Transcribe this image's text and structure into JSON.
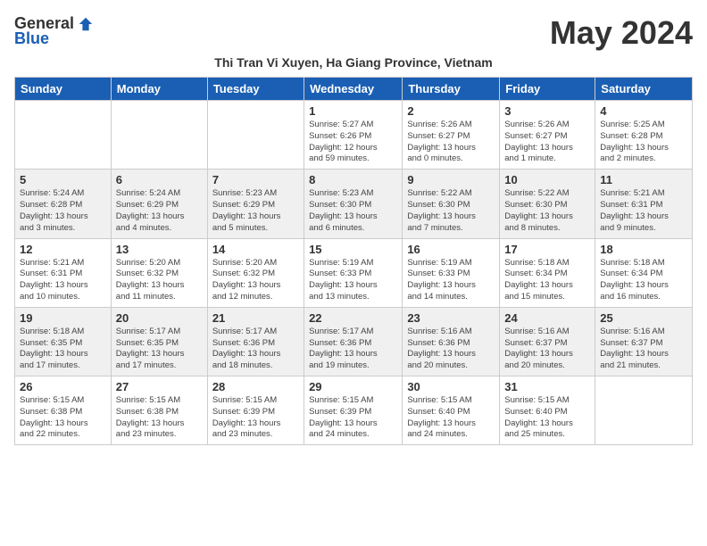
{
  "header": {
    "logo_general": "General",
    "logo_blue": "Blue",
    "month_title": "May 2024",
    "subtitle": "Thi Tran Vi Xuyen, Ha Giang Province, Vietnam"
  },
  "weekdays": [
    "Sunday",
    "Monday",
    "Tuesday",
    "Wednesday",
    "Thursday",
    "Friday",
    "Saturday"
  ],
  "weeks": [
    [
      {
        "day": "",
        "info": ""
      },
      {
        "day": "",
        "info": ""
      },
      {
        "day": "",
        "info": ""
      },
      {
        "day": "1",
        "info": "Sunrise: 5:27 AM\nSunset: 6:26 PM\nDaylight: 12 hours\nand 59 minutes."
      },
      {
        "day": "2",
        "info": "Sunrise: 5:26 AM\nSunset: 6:27 PM\nDaylight: 13 hours\nand 0 minutes."
      },
      {
        "day": "3",
        "info": "Sunrise: 5:26 AM\nSunset: 6:27 PM\nDaylight: 13 hours\nand 1 minute."
      },
      {
        "day": "4",
        "info": "Sunrise: 5:25 AM\nSunset: 6:28 PM\nDaylight: 13 hours\nand 2 minutes."
      }
    ],
    [
      {
        "day": "5",
        "info": "Sunrise: 5:24 AM\nSunset: 6:28 PM\nDaylight: 13 hours\nand 3 minutes."
      },
      {
        "day": "6",
        "info": "Sunrise: 5:24 AM\nSunset: 6:29 PM\nDaylight: 13 hours\nand 4 minutes."
      },
      {
        "day": "7",
        "info": "Sunrise: 5:23 AM\nSunset: 6:29 PM\nDaylight: 13 hours\nand 5 minutes."
      },
      {
        "day": "8",
        "info": "Sunrise: 5:23 AM\nSunset: 6:30 PM\nDaylight: 13 hours\nand 6 minutes."
      },
      {
        "day": "9",
        "info": "Sunrise: 5:22 AM\nSunset: 6:30 PM\nDaylight: 13 hours\nand 7 minutes."
      },
      {
        "day": "10",
        "info": "Sunrise: 5:22 AM\nSunset: 6:30 PM\nDaylight: 13 hours\nand 8 minutes."
      },
      {
        "day": "11",
        "info": "Sunrise: 5:21 AM\nSunset: 6:31 PM\nDaylight: 13 hours\nand 9 minutes."
      }
    ],
    [
      {
        "day": "12",
        "info": "Sunrise: 5:21 AM\nSunset: 6:31 PM\nDaylight: 13 hours\nand 10 minutes."
      },
      {
        "day": "13",
        "info": "Sunrise: 5:20 AM\nSunset: 6:32 PM\nDaylight: 13 hours\nand 11 minutes."
      },
      {
        "day": "14",
        "info": "Sunrise: 5:20 AM\nSunset: 6:32 PM\nDaylight: 13 hours\nand 12 minutes."
      },
      {
        "day": "15",
        "info": "Sunrise: 5:19 AM\nSunset: 6:33 PM\nDaylight: 13 hours\nand 13 minutes."
      },
      {
        "day": "16",
        "info": "Sunrise: 5:19 AM\nSunset: 6:33 PM\nDaylight: 13 hours\nand 14 minutes."
      },
      {
        "day": "17",
        "info": "Sunrise: 5:18 AM\nSunset: 6:34 PM\nDaylight: 13 hours\nand 15 minutes."
      },
      {
        "day": "18",
        "info": "Sunrise: 5:18 AM\nSunset: 6:34 PM\nDaylight: 13 hours\nand 16 minutes."
      }
    ],
    [
      {
        "day": "19",
        "info": "Sunrise: 5:18 AM\nSunset: 6:35 PM\nDaylight: 13 hours\nand 17 minutes."
      },
      {
        "day": "20",
        "info": "Sunrise: 5:17 AM\nSunset: 6:35 PM\nDaylight: 13 hours\nand 17 minutes."
      },
      {
        "day": "21",
        "info": "Sunrise: 5:17 AM\nSunset: 6:36 PM\nDaylight: 13 hours\nand 18 minutes."
      },
      {
        "day": "22",
        "info": "Sunrise: 5:17 AM\nSunset: 6:36 PM\nDaylight: 13 hours\nand 19 minutes."
      },
      {
        "day": "23",
        "info": "Sunrise: 5:16 AM\nSunset: 6:36 PM\nDaylight: 13 hours\nand 20 minutes."
      },
      {
        "day": "24",
        "info": "Sunrise: 5:16 AM\nSunset: 6:37 PM\nDaylight: 13 hours\nand 20 minutes."
      },
      {
        "day": "25",
        "info": "Sunrise: 5:16 AM\nSunset: 6:37 PM\nDaylight: 13 hours\nand 21 minutes."
      }
    ],
    [
      {
        "day": "26",
        "info": "Sunrise: 5:15 AM\nSunset: 6:38 PM\nDaylight: 13 hours\nand 22 minutes."
      },
      {
        "day": "27",
        "info": "Sunrise: 5:15 AM\nSunset: 6:38 PM\nDaylight: 13 hours\nand 23 minutes."
      },
      {
        "day": "28",
        "info": "Sunrise: 5:15 AM\nSunset: 6:39 PM\nDaylight: 13 hours\nand 23 minutes."
      },
      {
        "day": "29",
        "info": "Sunrise: 5:15 AM\nSunset: 6:39 PM\nDaylight: 13 hours\nand 24 minutes."
      },
      {
        "day": "30",
        "info": "Sunrise: 5:15 AM\nSunset: 6:40 PM\nDaylight: 13 hours\nand 24 minutes."
      },
      {
        "day": "31",
        "info": "Sunrise: 5:15 AM\nSunset: 6:40 PM\nDaylight: 13 hours\nand 25 minutes."
      },
      {
        "day": "",
        "info": ""
      }
    ]
  ]
}
